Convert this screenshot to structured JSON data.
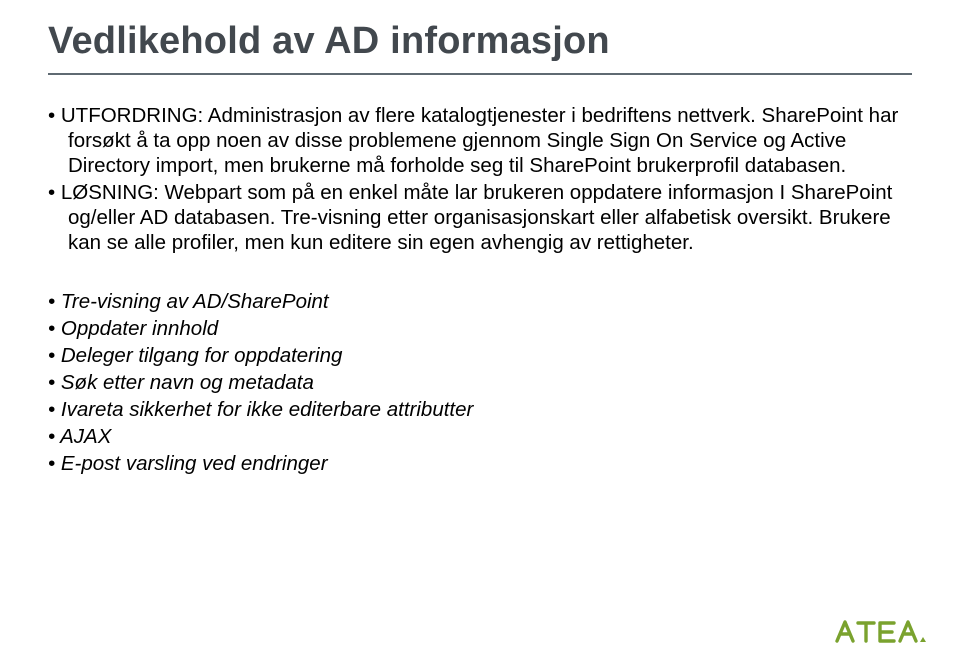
{
  "title": "Vedlikehold av AD informasjon",
  "bullets": [
    "UTFORDRING: Administrasjon av flere katalogtjenester i bedriftens nettverk. SharePoint har forsøkt å ta opp noen av disse problemene gjennom Single Sign On Service og Active Directory import, men brukerne må forholde seg til SharePoint brukerprofil databasen.",
    "LØSNING: Webpart som på en enkel måte lar brukeren oppdatere informasjon I SharePoint og/eller AD databasen. Tre-visning etter organisasjonskart eller alfabetisk oversikt. Brukere kan se alle profiler, men kun editere sin egen avhengig av rettigheter."
  ],
  "features": [
    "Tre-visning av AD/SharePoint",
    "Oppdater innhold",
    "Deleger tilgang for oppdatering",
    "Søk etter navn og metadata",
    "Ivareta sikkerhet for ikke editerbare attributter",
    "AJAX",
    "E-post varsling ved endringer"
  ],
  "logo_name": "ATEA"
}
